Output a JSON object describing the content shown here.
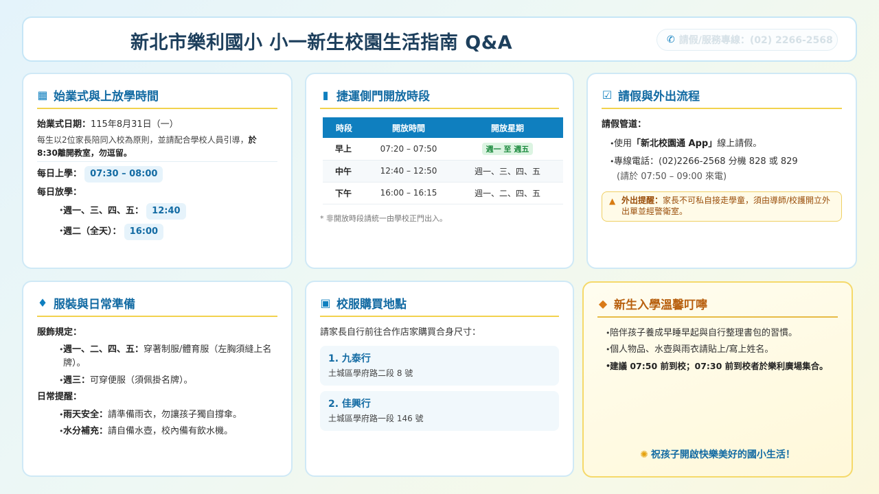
{
  "header": {
    "title": "新北市樂利國小 小一新生校園生活指南 Q&A",
    "hotline": "請假/服務專線：(02) 2266-2568"
  },
  "schedule": {
    "title": "始業式與上放學時間",
    "opening_label": "始業式日期：",
    "opening_value": "115年8月31日（一）",
    "note_normal": "每生以2位家長陪同入校為原則，並請配合學校人員引導，",
    "note_bold": "於 8:30離開教室，勿逗留。",
    "arrive_label": "每日上學：",
    "arrive_value": "07:30 – 08:00",
    "leave_label": "每日放學：",
    "leave_rows": [
      {
        "label": "週一、三、四、五：",
        "value": "12:40"
      },
      {
        "label": "週二（全天）：",
        "value": "16:00"
      }
    ]
  },
  "gate": {
    "title": "捷運側門開放時段",
    "headers": [
      "時段",
      "開放時間",
      "開放星期"
    ],
    "rows": [
      {
        "period": "早上",
        "time": "07:20 – 07:50",
        "days": "週一 至 週五"
      },
      {
        "period": "中午",
        "time": "12:40 – 12:50",
        "days": "週一、三、四、五"
      },
      {
        "period": "下午",
        "time": "16:00 – 16:15",
        "days": "週一、二、四、五"
      }
    ],
    "footnote": "* 非開放時段請統一由學校正門出入。"
  },
  "leave": {
    "title": "請假與外出流程",
    "channel_label": "請假管道：",
    "app_pre": "使用",
    "app_name": "「新北校園通 App」",
    "app_post": "線上請假。",
    "phone": "專線電話：(02)2266-2568 分機 828 或 829",
    "phone_hours": "(請於 07:50 – 09:00 來電)",
    "alert_label": "外出提醒：",
    "alert_text": "家長不可私自接走學童，須由導師/校護開立外出單並經警衛室。"
  },
  "dress": {
    "title": "服裝與日常準備",
    "rule_label": "服飾規定：",
    "rules": [
      {
        "label": "週一、二、四、五：",
        "text": "穿著制服/體育服（左胸須縫上名牌）。"
      },
      {
        "label": "週三：",
        "text": "可穿便服（須佩掛名牌）。"
      }
    ],
    "daily_label": "日常提醒：",
    "daily": [
      {
        "label": "雨天安全：",
        "text": "請準備雨衣，勿讓孩子獨自撐傘。"
      },
      {
        "label": "水分補充：",
        "text": "請自備水壺，校內備有飲水機。"
      }
    ]
  },
  "uniform": {
    "title": "校服購買地點",
    "intro": "請家長自行前往合作店家購買合身尺寸：",
    "stores": [
      {
        "name": "1. 九泰行",
        "address": "土城區學府路二段 8 號"
      },
      {
        "name": "2. 佳興行",
        "address": "土城區學府路一段 146 號"
      }
    ]
  },
  "tips": {
    "title": "新生入學溫馨叮嚀",
    "items": [
      {
        "text": "陪伴孩子養成早睡早起與自行整理書包的習慣。"
      },
      {
        "text": "個人物品、水壺與雨衣請貼上/寫上姓名。"
      }
    ],
    "advice": "建議 07:50 前到校；07:30 前到校者於樂利廣場集合。",
    "closing": "祝孩子開啟快樂美好的國小生活！"
  },
  "colors": {
    "primary": "#0f7fbf",
    "accent_yellow": "#f2d24d",
    "warm_title": "#b8600f"
  }
}
